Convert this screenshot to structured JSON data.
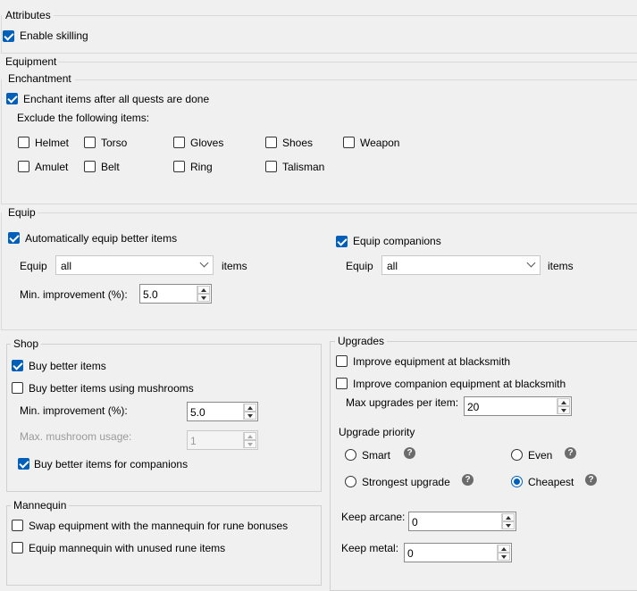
{
  "attributes": {
    "title": "Attributes",
    "enable_skilling": "Enable skilling"
  },
  "equipment": {
    "title": "Equipment"
  },
  "enchantment": {
    "title": "Enchantment",
    "enchant_label": "Enchant items after all quests are done",
    "exclude_label": "Exclude the following items:",
    "items": [
      "Helmet",
      "Torso",
      "Gloves",
      "Shoes",
      "Weapon",
      "Amulet",
      "Belt",
      "Ring",
      "Talisman"
    ]
  },
  "equip": {
    "title": "Equip",
    "auto_equip": "Automatically equip better items",
    "equip_label": "Equip",
    "equip_value": "all",
    "items_label": "items",
    "min_improvement_label": "Min. improvement (%):",
    "min_improvement_value": "5.0",
    "equip_companions": "Equip companions",
    "comp_equip_label": "Equip",
    "comp_equip_value": "all",
    "comp_items_label": "items"
  },
  "shop": {
    "title": "Shop",
    "buy_better": "Buy better items",
    "buy_mushrooms": "Buy better items using mushrooms",
    "min_improvement_label": "Min. improvement (%):",
    "min_improvement_value": "5.0",
    "max_mushroom_label": "Max. mushroom usage:",
    "max_mushroom_value": "1",
    "buy_companions": "Buy better items for companions"
  },
  "mannequin": {
    "title": "Mannequin",
    "swap": "Swap equipment with the mannequin for rune bonuses",
    "equip_unused": "Equip mannequin with unused rune items"
  },
  "upgrades": {
    "title": "Upgrades",
    "improve_equipment": "Improve equipment at blacksmith",
    "improve_companion": "Improve companion equipment at blacksmith",
    "max_upgrades_label": "Max upgrades per item:",
    "max_upgrades_value": "20",
    "priority_title": "Upgrade priority",
    "priority_options": [
      "Smart",
      "Even",
      "Strongest upgrade",
      "Cheapest"
    ],
    "help_glyph": "?",
    "keep_arcane_label": "Keep arcane:",
    "keep_arcane_value": "0",
    "keep_metal_label": "Keep metal:",
    "keep_metal_value": "0"
  },
  "colors": {
    "accent": "#005fb8",
    "border": "#d0d0d0",
    "background": "#f0f0f0"
  }
}
